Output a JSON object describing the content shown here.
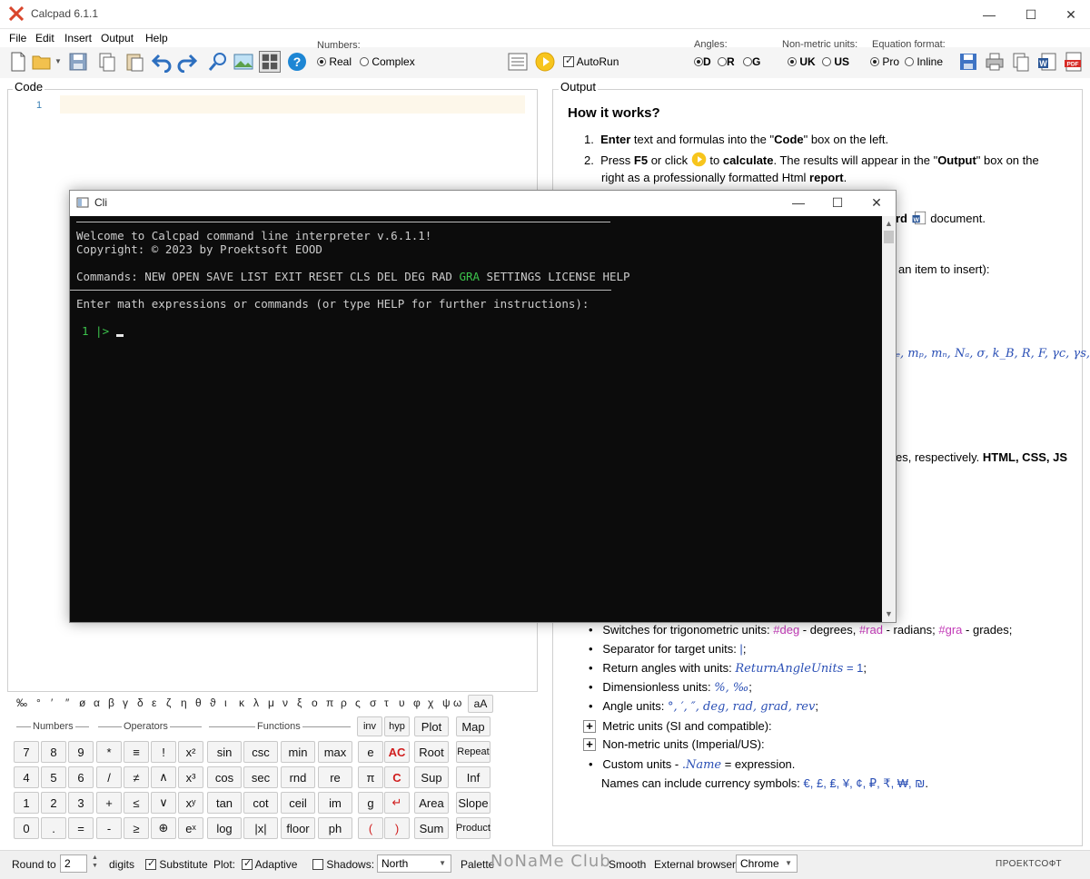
{
  "window": {
    "title": "Calcpad 6.1.1"
  },
  "menu": [
    "File",
    "Edit",
    "Insert",
    "Output",
    "Help"
  ],
  "toolbar": {
    "numbers_label": "Numbers:",
    "numbers_options": [
      "Real",
      "Complex"
    ],
    "autorun_label": "AutoRun",
    "angles_label": "Angles:",
    "angles_options": [
      "D",
      "R",
      "G"
    ],
    "nonmetric_label": "Non-metric units:",
    "nonmetric_options": [
      "UK",
      "US"
    ],
    "equation_label": "Equation format:",
    "equation_options": [
      "Pro",
      "Inline"
    ]
  },
  "code": {
    "label": "Code",
    "line_number": "1"
  },
  "output": {
    "label": "Output",
    "heading": "How it works?",
    "step1_pre": "1.",
    "step1_bold": "Enter",
    "step1_a": " text and formulas into the \"",
    "step1_code": "Code",
    "step1_b": "\" box on the left.",
    "step2_pre": "2.",
    "step2_a": "Press ",
    "step2_f5": "F5",
    "step2_b": " or click ",
    "step2_c": " to ",
    "step2_calc": "calculate",
    "step2_d": ". The results will appear in the \"",
    "step2_out": "Output",
    "step2_e": "\" box on the",
    "step2_line2_a": "right as a professionally formatted Html ",
    "step2_report": "report",
    "step2_line2_b": ".",
    "frag_word": "rd",
    "frag_doc": " document.",
    "frag_insert": "an item to insert):",
    "frag_consts": "e, m",
    "frag_consts_full": "ₑ, mₚ, mₙ, Nₐ, σ, k_B, R, F, γc, γs,",
    "frag_resp_a": "es, respectively. ",
    "frag_resp_b": "HTML, CSS, JS",
    "b1_a": "Switches for trigonometric units: ",
    "b1_deg": "#deg",
    "b1_b": " - degrees, ",
    "b1_rad": "#rad",
    "b1_c": " - radians; ",
    "b1_gra": "#gra",
    "b1_d": " - grades;",
    "b2_a": "Separator for target units: ",
    "b2_sep": "|",
    "b2_b": ";",
    "b3_a": "Return angles with units: ",
    "b3_var": "ReturnAngleUnits",
    "b3_eq": " = 1",
    "b3_b": ";",
    "b4_a": "Dimensionless units: ",
    "b4_u": "%, ‰",
    "b4_b": ";",
    "b5_a": "Angle units: ",
    "b5_u": "°, ′, ″, deg, rad, grad, rev",
    "b5_b": ";",
    "e1": "Metric units (SI and compatible):",
    "e2": "Non-metric units (Imperial/US):",
    "b6_a": "Custom units - ",
    "b6_name": ".Name",
    "b6_b": " = expression.",
    "b7_a": "Names can include currency symbols: ",
    "b7_sym": "€, £, ₤, ¥, ¢, ₽, ₹, ₩, ₪",
    "b7_b": "."
  },
  "cli": {
    "title": "Cli",
    "welcome": "Welcome to Calcpad command line interpreter v.6.1.1!",
    "copyright": "Copyright: © 2023 by Proektsoft EOOD",
    "commands_prefix": "Commands: NEW OPEN SAVE LIST EXIT RESET CLS DEL DEG RAD ",
    "commands_gra": "GRA",
    "commands_suffix": " SETTINGS LICENSE HELP",
    "prompt_text": "Enter math expressions or commands (or type HELP for further instructions):",
    "prompt_line": "1 |>"
  },
  "keypad": {
    "greek": [
      "‰",
      "°",
      "′",
      "″",
      "ø",
      "α",
      "β",
      "γ",
      "δ",
      "ε",
      "ζ",
      "η",
      "θ",
      "ϑ",
      "ι",
      "κ",
      "λ",
      "μ",
      "ν",
      "ξ",
      "ο",
      "π",
      "ρ",
      "ς",
      "σ",
      "τ",
      "υ",
      "φ",
      "χ",
      "ψ",
      "ω"
    ],
    "case_button": "aA",
    "groups": [
      "Numbers",
      "Operators",
      "Functions"
    ],
    "top_row": [
      "inv",
      "hyp",
      "Plot",
      "Map"
    ],
    "rows": [
      [
        "7",
        "8",
        "9",
        "*",
        "≡",
        "!",
        "x²",
        "sin",
        "csc",
        "min",
        "max",
        "e",
        "AC",
        "Root",
        "Repeat"
      ],
      [
        "4",
        "5",
        "6",
        "/",
        "≠",
        "∧",
        "x³",
        "cos",
        "sec",
        "rnd",
        "re",
        "π",
        "C",
        "Sup",
        "Inf"
      ],
      [
        "1",
        "2",
        "3",
        "+",
        "≤",
        "∨",
        "xʸ",
        "tan",
        "cot",
        "ceil",
        "im",
        "g",
        "↵",
        "Area",
        "Slope"
      ],
      [
        "0",
        ".",
        "=",
        "-",
        "≥",
        "⊕",
        "eˣ",
        "log",
        "|x|",
        "floor",
        "ph",
        "(",
        ")",
        "Sum",
        "Product"
      ]
    ]
  },
  "status": {
    "round_label": "Round to",
    "round_value": "2",
    "digits_label": "digits",
    "substitute": "Substitute",
    "plot_label": "Plot:",
    "adaptive": "Adaptive",
    "shadows": "Shadows:",
    "shadows_value": "North",
    "palette": "Palette",
    "smooth": "Smooth",
    "browser_label": "External browser:",
    "browser_value": "Chrome",
    "brand": "ПРОЕКТСОФТ",
    "watermark": "NoNaMe Club"
  }
}
